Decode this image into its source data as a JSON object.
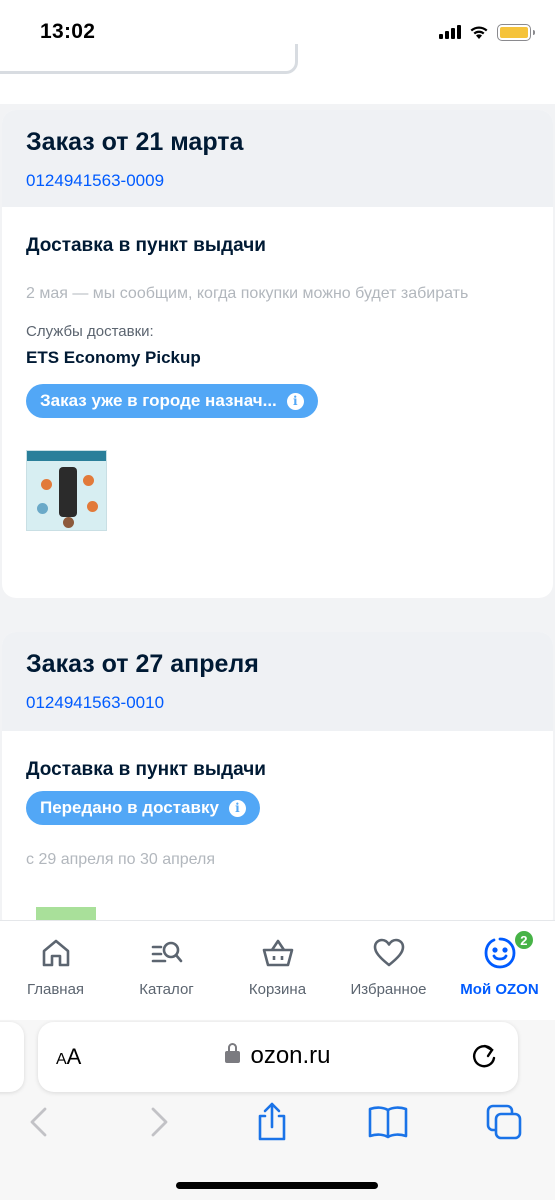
{
  "status_bar": {
    "time": "13:02"
  },
  "orders": [
    {
      "title": "Заказ от 21 марта",
      "number": "0124941563-0009",
      "delivery_title": "Доставка в пункт выдачи",
      "date_text": "2 мая — мы сообщим, когда покупки можно будет забирать",
      "service_label": "Службы доставки:",
      "service_name": "ETS Economy Pickup",
      "status_chip": "Заказ уже в городе назнач..."
    },
    {
      "title": "Заказ от 27 апреля",
      "number": "0124941563-0010",
      "delivery_title": "Доставка в пункт выдачи",
      "status_chip": "Передано в доставку",
      "date_text": "с 29 апреля по 30 апреля"
    }
  ],
  "tabbar": {
    "items": [
      {
        "label": "Главная",
        "icon": "home-icon"
      },
      {
        "label": "Каталог",
        "icon": "catalog-search-icon"
      },
      {
        "label": "Корзина",
        "icon": "basket-icon"
      },
      {
        "label": "Избранное",
        "icon": "heart-icon"
      },
      {
        "label": "Мой OZON",
        "icon": "smile-profile-icon",
        "badge": "2",
        "active": true
      }
    ]
  },
  "browser": {
    "text_size_label_small": "A",
    "text_size_label_large": "A",
    "url": "ozon.ru"
  },
  "colors": {
    "accent": "#005bff",
    "chip": "#52a7f6",
    "badge": "#47b347"
  }
}
